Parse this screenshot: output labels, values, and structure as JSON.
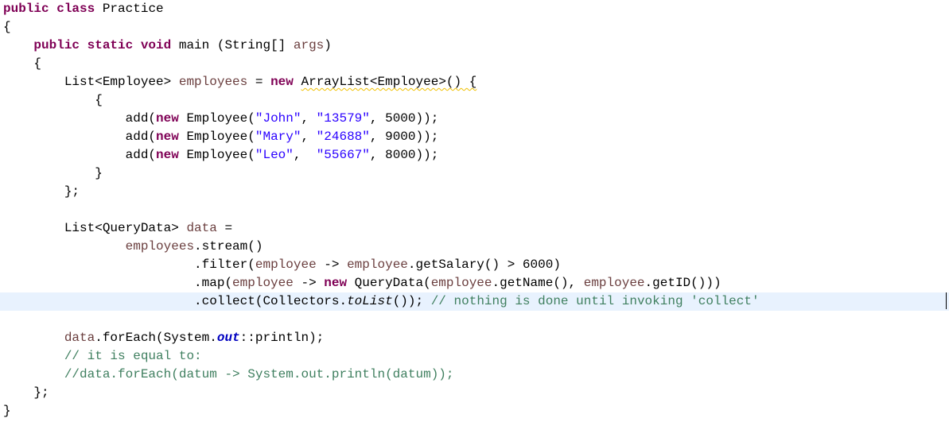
{
  "editor": {
    "lines": [
      [
        {
          "t": "public class ",
          "c": "kw"
        },
        {
          "t": "Practice",
          "c": ""
        }
      ],
      [
        {
          "t": "{",
          "c": ""
        }
      ],
      [
        {
          "t": "    public static void ",
          "c": "kw"
        },
        {
          "t": "main (String[] ",
          "c": ""
        },
        {
          "t": "args",
          "c": "var"
        },
        {
          "t": ")",
          "c": ""
        }
      ],
      [
        {
          "t": "    {",
          "c": ""
        }
      ],
      [
        {
          "t": "        List<Employee> ",
          "c": ""
        },
        {
          "t": "employees",
          "c": "var"
        },
        {
          "t": " = ",
          "c": ""
        },
        {
          "t": "new ",
          "c": "kw"
        },
        {
          "t": "ArrayList<Employee>() {",
          "c": "squiggle"
        }
      ],
      [
        {
          "t": "            {",
          "c": ""
        }
      ],
      [
        {
          "t": "                add(",
          "c": ""
        },
        {
          "t": "new ",
          "c": "kw"
        },
        {
          "t": "Employee(",
          "c": ""
        },
        {
          "t": "\"John\"",
          "c": "str"
        },
        {
          "t": ", ",
          "c": ""
        },
        {
          "t": "\"13579\"",
          "c": "str"
        },
        {
          "t": ", 5000));",
          "c": ""
        }
      ],
      [
        {
          "t": "                add(",
          "c": ""
        },
        {
          "t": "new ",
          "c": "kw"
        },
        {
          "t": "Employee(",
          "c": ""
        },
        {
          "t": "\"Mary\"",
          "c": "str"
        },
        {
          "t": ", ",
          "c": ""
        },
        {
          "t": "\"24688\"",
          "c": "str"
        },
        {
          "t": ", 9000));",
          "c": ""
        }
      ],
      [
        {
          "t": "                add(",
          "c": ""
        },
        {
          "t": "new ",
          "c": "kw"
        },
        {
          "t": "Employee(",
          "c": ""
        },
        {
          "t": "\"Leo\"",
          "c": "str"
        },
        {
          "t": ",  ",
          "c": ""
        },
        {
          "t": "\"55667\"",
          "c": "str"
        },
        {
          "t": ", 8000));",
          "c": ""
        }
      ],
      [
        {
          "t": "            }",
          "c": ""
        }
      ],
      [
        {
          "t": "        };",
          "c": ""
        }
      ],
      [
        {
          "t": "",
          "c": ""
        }
      ],
      [
        {
          "t": "        List<QueryData> ",
          "c": ""
        },
        {
          "t": "data",
          "c": "var"
        },
        {
          "t": " =",
          "c": ""
        }
      ],
      [
        {
          "t": "                ",
          "c": ""
        },
        {
          "t": "employees",
          "c": "var"
        },
        {
          "t": ".stream()",
          "c": ""
        }
      ],
      [
        {
          "t": "                         .filter(",
          "c": ""
        },
        {
          "t": "employee",
          "c": "var"
        },
        {
          "t": " -> ",
          "c": ""
        },
        {
          "t": "employee",
          "c": "var"
        },
        {
          "t": ".getSalary() > 6000)",
          "c": ""
        }
      ],
      [
        {
          "t": "                         .map(",
          "c": ""
        },
        {
          "t": "employee",
          "c": "var"
        },
        {
          "t": " -> ",
          "c": ""
        },
        {
          "t": "new ",
          "c": "kw"
        },
        {
          "t": "QueryData(",
          "c": ""
        },
        {
          "t": "employee",
          "c": "var"
        },
        {
          "t": ".getName(), ",
          "c": ""
        },
        {
          "t": "employee",
          "c": "var"
        },
        {
          "t": ".getID()))",
          "c": ""
        }
      ],
      [
        {
          "t": "                         .collect(Collectors.",
          "c": ""
        },
        {
          "t": "toList",
          "c": "st"
        },
        {
          "t": "()); ",
          "c": ""
        },
        {
          "t": "// nothing is done until invoking 'collect'",
          "c": "cmt"
        }
      ],
      [
        {
          "t": "",
          "c": ""
        }
      ],
      [
        {
          "t": "        ",
          "c": ""
        },
        {
          "t": "data",
          "c": "var"
        },
        {
          "t": ".forEach(System.",
          "c": ""
        },
        {
          "t": "out",
          "c": "fld"
        },
        {
          "t": "::println);",
          "c": ""
        }
      ],
      [
        {
          "t": "        // it is equal to:",
          "c": "cmt"
        }
      ],
      [
        {
          "t": "        //data.forEach(datum -> System.out.println(datum));",
          "c": "cmt"
        }
      ],
      [
        {
          "t": "    };",
          "c": ""
        }
      ],
      [
        {
          "t": "}",
          "c": ""
        }
      ]
    ],
    "current_line": 16,
    "colors": {
      "keyword": "#7f0055",
      "variable": "#6a3e3e",
      "string": "#2a00ff",
      "comment": "#3f7f5f",
      "static_field": "#0000c0",
      "current_line_bg": "#e8f2fe"
    }
  }
}
